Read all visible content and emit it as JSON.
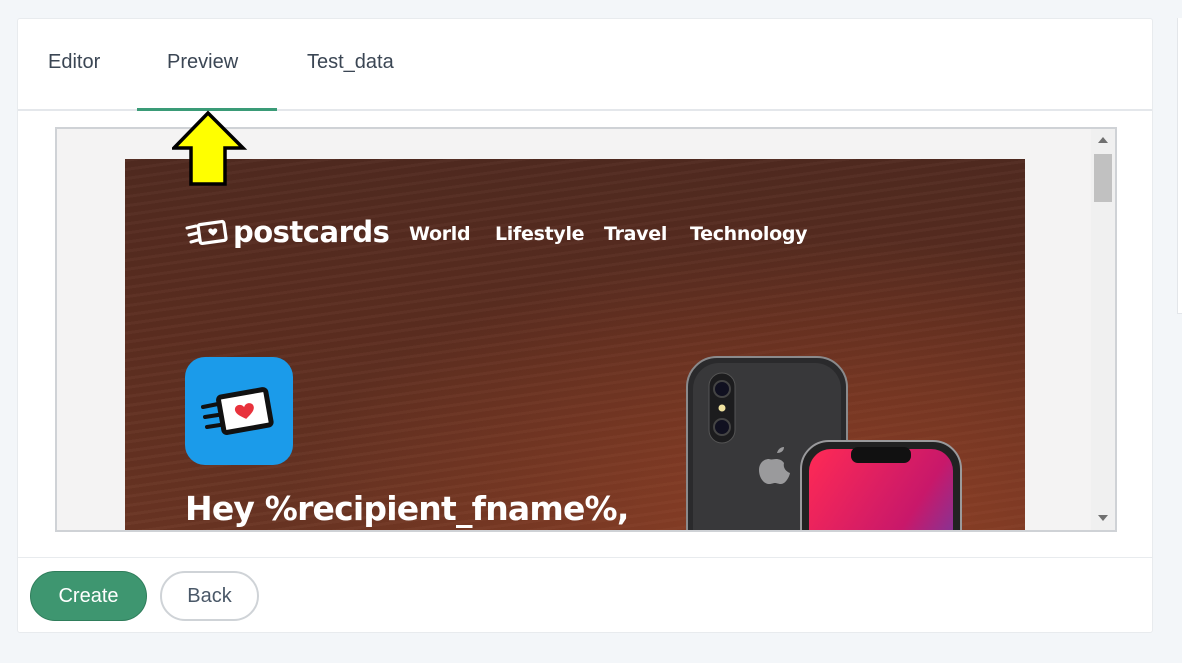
{
  "tabs": [
    {
      "label": "Editor"
    },
    {
      "label": "Preview"
    },
    {
      "label": "Test_data"
    }
  ],
  "active_tab": "Preview",
  "preview": {
    "logo_text": "postcards",
    "nav": [
      "World",
      "Lifestyle",
      "Travel",
      "Technology"
    ],
    "greeting": "Hey %recipient_fname%,"
  },
  "buttons": {
    "create": "Create",
    "back": "Back"
  },
  "colors": {
    "accent": "#3a9b77",
    "create_button": "#3e9670",
    "hero_background": "#5c2d20",
    "app_icon": "#1b9bea",
    "annotation_arrow": "#ffff00"
  }
}
